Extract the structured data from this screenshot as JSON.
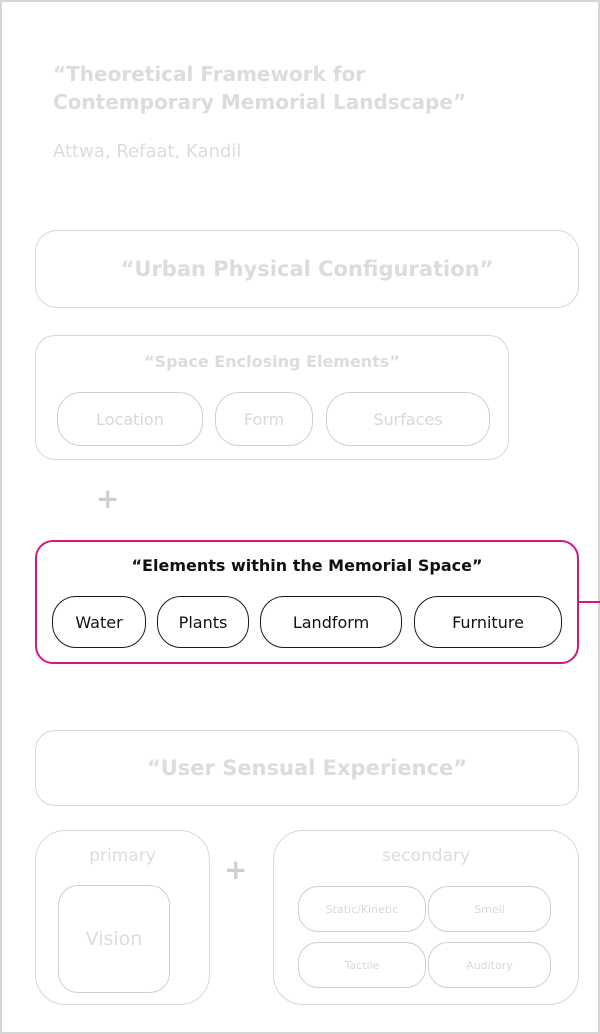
{
  "header": {
    "title_line1": "“Theoretical Framework for",
    "title_line2": "Contemporary Memorial Landscape”",
    "authors": "Attwa, Refaat, Kandil"
  },
  "physical": {
    "title": "“Urban Physical Configuration”",
    "enclosing": {
      "title": "“Space Enclosing Elements”",
      "items": [
        "Location",
        "Form",
        "Surfaces"
      ]
    },
    "plus": "+",
    "within": {
      "title": "“Elements within the Memorial Space”",
      "items": [
        "Water",
        "Plants",
        "Landform",
        "Furniture"
      ]
    }
  },
  "sensual": {
    "title": "“User Sensual Experience”",
    "primary": {
      "label": "primary",
      "items": [
        "Vision"
      ]
    },
    "plus": "+",
    "secondary": {
      "label": "secondary",
      "items": [
        "Static/Kinetic",
        "Smell",
        "Tactile",
        "Auditory"
      ]
    }
  },
  "colors": {
    "highlight": "#d6177f",
    "faint_text": "#dcdcdc",
    "faint_border": "#d7d7d7"
  }
}
